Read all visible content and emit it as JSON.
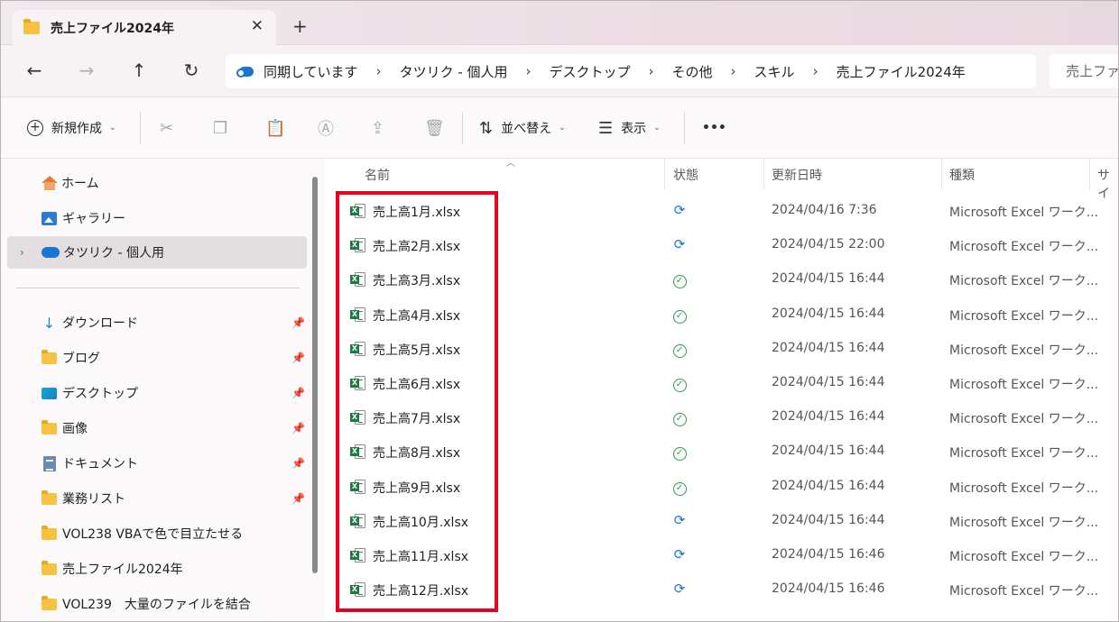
{
  "tab": {
    "title": "売上ファイル2024年",
    "close": "✕",
    "new_tab": "+"
  },
  "nav": {
    "back": "←",
    "forward": "→",
    "up": "↑",
    "refresh": "↻"
  },
  "address": {
    "crumbs": [
      "同期しています",
      "タツリク - 個人用",
      "デスクトップ",
      "その他",
      "スキル",
      "売上ファイル2024年"
    ],
    "separator": "›"
  },
  "search": {
    "placeholder": "売上ファ"
  },
  "toolbar": {
    "new_label": "新規作成",
    "sort_label": "並べ替え",
    "view_label": "表示",
    "more": "•••",
    "caret": "⌄"
  },
  "sidebar": {
    "items": [
      {
        "label": "ホーム",
        "icon": "home-icon"
      },
      {
        "label": "ギャラリー",
        "icon": "gallery-icon"
      },
      {
        "label": "タツリク - 個人用",
        "icon": "onedrive-cloud-icon",
        "selected": true
      },
      {
        "label": "ダウンロード",
        "icon": "download-icon",
        "pinned": true
      },
      {
        "label": "ブログ",
        "icon": "folder-icon",
        "pinned": true
      },
      {
        "label": "デスクトップ",
        "icon": "desktop-icon",
        "pinned": true
      },
      {
        "label": "画像",
        "icon": "folder-icon",
        "pinned": true
      },
      {
        "label": "ドキュメント",
        "icon": "document-icon",
        "pinned": true
      },
      {
        "label": "業務リスト",
        "icon": "folder-icon",
        "pinned": true
      },
      {
        "label": "VOL238 VBAで色で目立たせる",
        "icon": "folder-icon"
      },
      {
        "label": "売上ファイル2024年",
        "icon": "folder-icon"
      },
      {
        "label": "VOL239　大量のファイルを結合",
        "icon": "folder-icon"
      }
    ],
    "pin_glyph": "📌",
    "expander": "›"
  },
  "columns": {
    "name": "名前",
    "status": "状態",
    "modified": "更新日時",
    "type": "種類",
    "size": "サイ"
  },
  "files": [
    {
      "name": "売上高1月.xlsx",
      "status": "syncing",
      "modified": "2024/04/16 7:36",
      "type": "Microsoft Excel ワーク..."
    },
    {
      "name": "売上高2月.xlsx",
      "status": "syncing",
      "modified": "2024/04/15 22:00",
      "type": "Microsoft Excel ワーク..."
    },
    {
      "name": "売上高3月.xlsx",
      "status": "synced",
      "modified": "2024/04/15 16:44",
      "type": "Microsoft Excel ワーク..."
    },
    {
      "name": "売上高4月.xlsx",
      "status": "synced",
      "modified": "2024/04/15 16:44",
      "type": "Microsoft Excel ワーク..."
    },
    {
      "name": "売上高5月.xlsx",
      "status": "synced",
      "modified": "2024/04/15 16:44",
      "type": "Microsoft Excel ワーク..."
    },
    {
      "name": "売上高6月.xlsx",
      "status": "synced",
      "modified": "2024/04/15 16:44",
      "type": "Microsoft Excel ワーク..."
    },
    {
      "name": "売上高7月.xlsx",
      "status": "synced",
      "modified": "2024/04/15 16:44",
      "type": "Microsoft Excel ワーク..."
    },
    {
      "name": "売上高8月.xlsx",
      "status": "synced",
      "modified": "2024/04/15 16:44",
      "type": "Microsoft Excel ワーク..."
    },
    {
      "name": "売上高9月.xlsx",
      "status": "synced",
      "modified": "2024/04/15 16:44",
      "type": "Microsoft Excel ワーク..."
    },
    {
      "name": "売上高10月.xlsx",
      "status": "syncing",
      "modified": "2024/04/15 16:44",
      "type": "Microsoft Excel ワーク..."
    },
    {
      "name": "売上高11月.xlsx",
      "status": "syncing",
      "modified": "2024/04/15 16:46",
      "type": "Microsoft Excel ワーク..."
    },
    {
      "name": "売上高12月.xlsx",
      "status": "syncing",
      "modified": "2024/04/15 16:46",
      "type": "Microsoft Excel ワーク..."
    }
  ],
  "colors": {
    "highlight": "#e8001c",
    "sync_blue": "#1a74d1",
    "ok_green": "#2c9a4e",
    "excel_green": "#1e7b45"
  }
}
